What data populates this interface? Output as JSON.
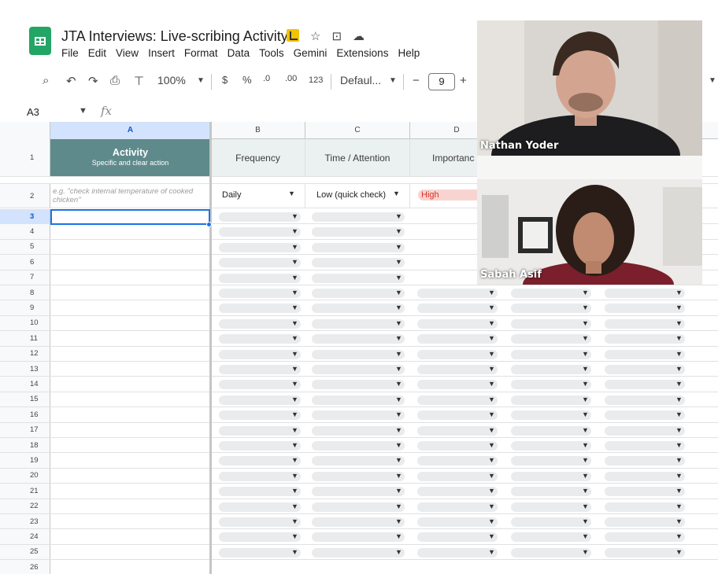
{
  "app": {
    "title": "JTA Interviews: Live-scribing Activity",
    "menu": [
      "File",
      "Edit",
      "View",
      "Insert",
      "Format",
      "Data",
      "Tools",
      "Gemini",
      "Extensions",
      "Help"
    ]
  },
  "toolbar": {
    "zoom": "100%",
    "currency": "$",
    "percent": "%",
    "decrease_decimals": ".0",
    "increase_decimals": ".00",
    "number_format": "123",
    "font": "Defaul...",
    "font_size": "9",
    "minus": "−",
    "plus": "+"
  },
  "formula_bar": {
    "cell_ref": "A3",
    "fx": "fx"
  },
  "columns": [
    "A",
    "B",
    "C",
    "D"
  ],
  "header_row": {
    "activity": "Activity",
    "activity_sub": "Specific and clear action",
    "frequency": "Frequency",
    "time": "Time / Attention",
    "importance": "Importanc"
  },
  "example_row": {
    "activity": "e.g. \"check internal temperature of cooked chicken\"",
    "frequency": "Daily",
    "time": "Low (quick check)",
    "importance": "High"
  },
  "row_numbers": [
    "1",
    "2",
    "3",
    "4",
    "5",
    "6",
    "7",
    "8",
    "9",
    "10",
    "11",
    "12",
    "13",
    "14",
    "15",
    "16",
    "17",
    "18",
    "19",
    "20",
    "21",
    "22",
    "23",
    "24",
    "25",
    "26"
  ],
  "participants": [
    {
      "name": "Nathan Yoder"
    },
    {
      "name": "Sabah Asif"
    }
  ],
  "colors": {
    "header_accent": "#5f8a8b",
    "header_light": "#ebf0f0",
    "importance_high_bg": "#f8d4d1",
    "importance_high_text": "#d93025",
    "selection": "#1a73e8",
    "sheets_green": "#23a566"
  },
  "icons": [
    "search-icon",
    "undo-icon",
    "redo-icon",
    "print-icon",
    "paint-format-icon",
    "star-icon",
    "move-to-folder-icon",
    "cloud-status-icon",
    "function-icon"
  ]
}
